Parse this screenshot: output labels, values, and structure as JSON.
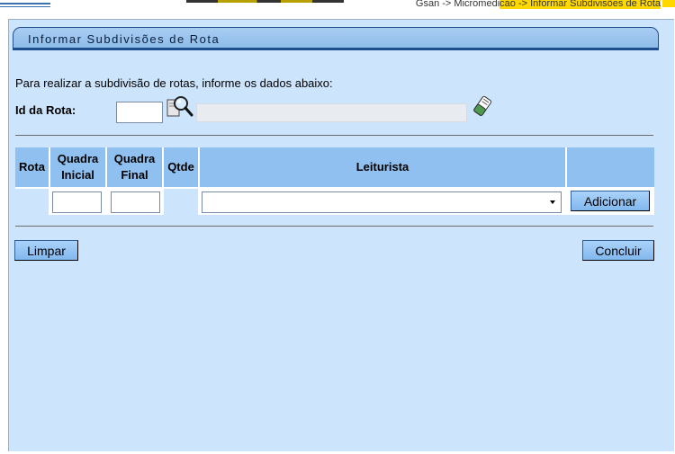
{
  "breadcrumb": {
    "text_plain": "Gsan -> Micromedi",
    "text_highlight": "cao -> Informar Subdivisões de Rota"
  },
  "form": {
    "title": "Informar Subdivisões de Rota",
    "instructions": "Para realizar a subdivisão de rotas, informe os dados abaixo:",
    "id_rota_label": "Id da Rota:",
    "id_rota_value": "",
    "id_rota_description": ""
  },
  "table": {
    "headers": {
      "rota": "Rota",
      "quadra_inicial_1": "Quadra",
      "quadra_inicial_2": "Inicial",
      "quadra_final_1": "Quadra",
      "quadra_final_2": "Final",
      "qtde": "Qtde",
      "leiturista": "Leiturista"
    },
    "row": {
      "quadra_inicial_value": "",
      "quadra_final_value": "",
      "leiturista_selected": ""
    },
    "add_button": "Adicionar"
  },
  "buttons": {
    "clear": "Limpar",
    "finish": "Concluir"
  },
  "colors": {
    "panel_bg": "#cce4fc",
    "header_bg": "#90c0f0",
    "title_border": "#1f4e8c",
    "breadcrumb_highlight": "#ffd800"
  }
}
